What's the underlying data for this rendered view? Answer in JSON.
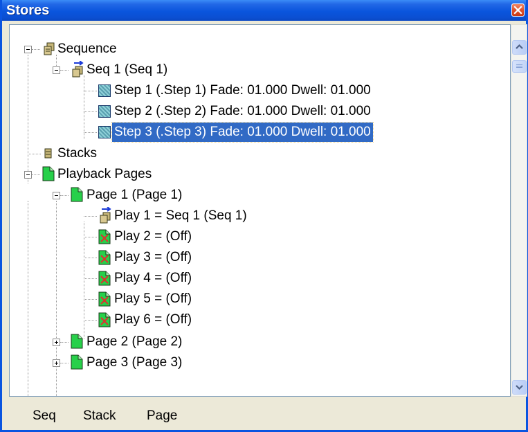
{
  "window": {
    "title": "Stores"
  },
  "tree": {
    "sequence": {
      "label": "Sequence",
      "seq1": {
        "label": "Seq 1 (Seq 1)",
        "steps": [
          "Step 1 (.Step 1) Fade: 01.000 Dwell: 01.000",
          "Step 2 (.Step 2) Fade: 01.000 Dwell: 01.000",
          "Step 3 (.Step 3) Fade: 01.000 Dwell: 01.000"
        ]
      }
    },
    "stacks": {
      "label": "Stacks"
    },
    "playback_pages": {
      "label": "Playback Pages",
      "pages": [
        {
          "label": "Page 1 (Page 1)",
          "plays": [
            "Play 1 = Seq 1 (Seq 1)",
            "Play 2 = (Off)",
            "Play 3 = (Off)",
            "Play 4 = (Off)",
            "Play 5 = (Off)",
            "Play 6 = (Off)"
          ]
        },
        {
          "label": "Page 2 (Page 2)"
        },
        {
          "label": "Page 3 (Page 3)"
        }
      ]
    },
    "selected": "Step 3 (.Step 3) Fade: 01.000 Dwell: 01.000"
  },
  "toolbar": {
    "buttons": [
      "Seq",
      "Stack",
      "Page"
    ]
  },
  "colors": {
    "title_bar": "#0a55dd",
    "selection": "#316ac5",
    "page_icon": "#27d04a",
    "off_mark": "#e03030"
  },
  "icons": {
    "sequence": "sequence-icon",
    "step": "step-icon",
    "stacks": "stack-icon",
    "page": "page-icon",
    "off": "off-play-icon",
    "expand": "expand-icon",
    "collapse": "collapse-icon"
  }
}
